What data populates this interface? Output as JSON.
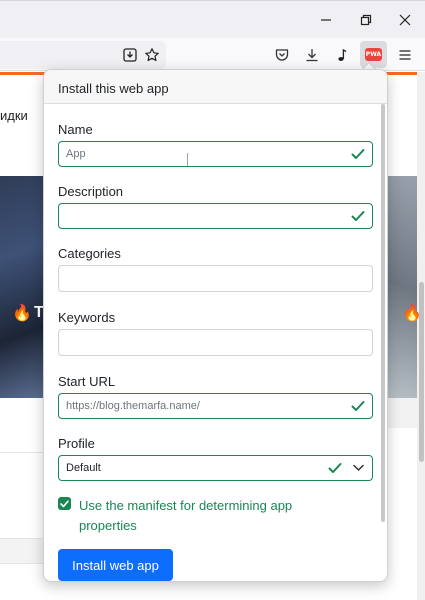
{
  "window": {
    "minimize_icon": "minimize-icon",
    "restore_icon": "restore-icon",
    "close_icon": "close-icon"
  },
  "toolbar": {
    "icons": [
      "reader-view-icon",
      "bookmark-star-icon",
      "pocket-icon",
      "downloads-icon",
      "music-note-icon",
      "pwa-icon",
      "menu-icon"
    ],
    "pwa_badge": "PWA"
  },
  "page": {
    "partial_text": "идки",
    "accent_color": "#f26c21",
    "card_left_text": "T"
  },
  "popup": {
    "title": "Install this web app",
    "fields": {
      "name": {
        "label": "Name",
        "value": "",
        "placeholder": "App",
        "valid": true
      },
      "description": {
        "label": "Description",
        "value": "",
        "placeholder": "",
        "valid": true
      },
      "categories": {
        "label": "Categories",
        "value": "",
        "placeholder": ""
      },
      "keywords": {
        "label": "Keywords",
        "value": "",
        "placeholder": ""
      },
      "start_url": {
        "label": "Start URL",
        "value": "",
        "placeholder": "https://blog.themarfa.name/",
        "valid": true
      },
      "profile": {
        "label": "Profile",
        "selected": "Default",
        "valid": true
      }
    },
    "manifest_checkbox": {
      "label": "Use the manifest for determining app properties",
      "checked": true
    },
    "install_button": "Install web app",
    "colors": {
      "valid": "#198754",
      "primary": "#0d6efd"
    }
  }
}
